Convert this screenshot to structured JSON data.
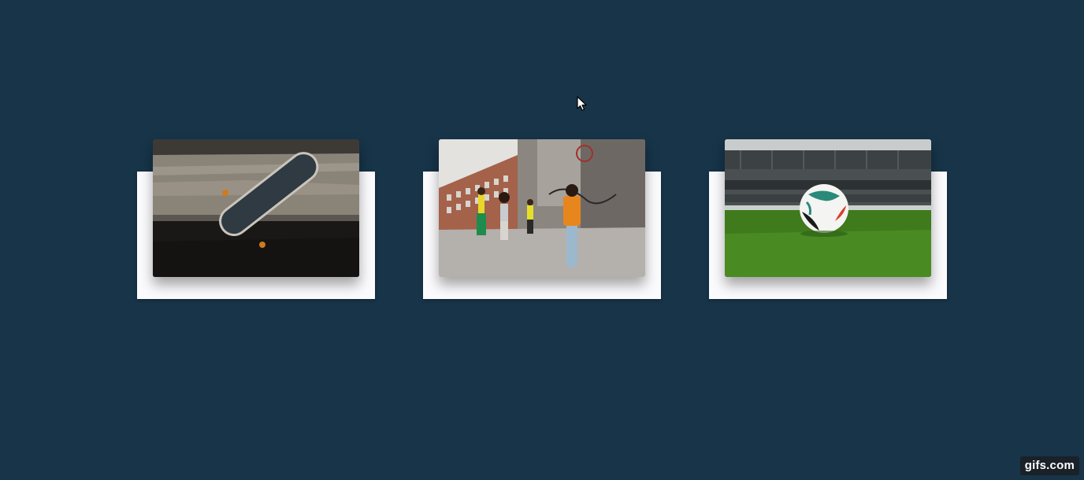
{
  "cards": [
    {
      "image": "skateboard-photo"
    },
    {
      "image": "street-kids-photo"
    },
    {
      "image": "soccer-ball-stadium-photo"
    }
  ],
  "cursor": {
    "icon": "arrow-cursor-icon"
  },
  "watermark": {
    "text": "gifs.com"
  },
  "colors": {
    "background": "#173449",
    "card": "#fbfbfd"
  }
}
